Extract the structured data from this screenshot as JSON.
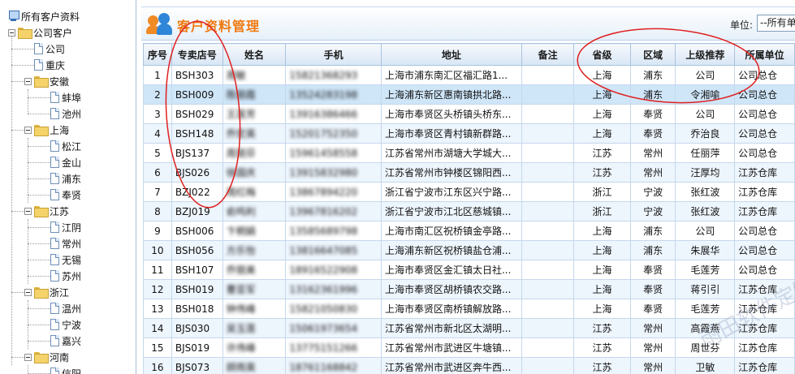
{
  "tree": {
    "root": "所有客户资料",
    "company": "公司客户",
    "nodes": [
      {
        "label": "公司",
        "level": 2,
        "type": "page"
      },
      {
        "label": "重庆",
        "level": 2,
        "type": "page"
      },
      {
        "label": "安徽",
        "level": 2,
        "type": "folder"
      },
      {
        "label": "蚌埠",
        "level": 3,
        "type": "page"
      },
      {
        "label": "池州",
        "level": 3,
        "type": "page"
      },
      {
        "label": "上海",
        "level": 2,
        "type": "folder"
      },
      {
        "label": "松江",
        "level": 3,
        "type": "page"
      },
      {
        "label": "金山",
        "level": 3,
        "type": "page"
      },
      {
        "label": "浦东",
        "level": 3,
        "type": "page"
      },
      {
        "label": "奉贤",
        "level": 3,
        "type": "page"
      },
      {
        "label": "江苏",
        "level": 2,
        "type": "folder"
      },
      {
        "label": "江阴",
        "level": 3,
        "type": "page"
      },
      {
        "label": "常州",
        "level": 3,
        "type": "page"
      },
      {
        "label": "无锡",
        "level": 3,
        "type": "page"
      },
      {
        "label": "苏州",
        "level": 3,
        "type": "page"
      },
      {
        "label": "浙江",
        "level": 2,
        "type": "folder"
      },
      {
        "label": "温州",
        "level": 3,
        "type": "page"
      },
      {
        "label": "宁波",
        "level": 3,
        "type": "page"
      },
      {
        "label": "嘉兴",
        "level": 3,
        "type": "page"
      },
      {
        "label": "河南",
        "level": 2,
        "type": "folder"
      },
      {
        "label": "信阳",
        "level": 3,
        "type": "page"
      }
    ]
  },
  "header": {
    "title": "客户资料管理",
    "unit_label": "单位:",
    "unit_value": "--所有单位--"
  },
  "columns": [
    "序号",
    "专卖店号",
    "姓名",
    "手机",
    "地址",
    "备注",
    "省级",
    "区域",
    "上级推荐",
    "所属单位"
  ],
  "rows": [
    {
      "no": "1",
      "store": "BSH303",
      "name": "周敏",
      "phone": "15821368293",
      "address": "上海市浦东南汇区福汇路1...",
      "note": "",
      "province": "上海",
      "region": "浦东",
      "referrer": "公司",
      "unit": "公司总仓"
    },
    {
      "no": "2",
      "store": "BSH009",
      "name": "陈丽霞",
      "phone": "13524283198",
      "address": "上海浦东新区惠南镇拱北路...",
      "note": "",
      "province": "上海",
      "region": "浦东",
      "referrer": "令湘喻",
      "unit": "公司总仓"
    },
    {
      "no": "3",
      "store": "BSH029",
      "name": "王莲芳",
      "phone": "13916386466",
      "address": "上海市奉贤区头桥镇头桥东...",
      "note": "",
      "province": "上海",
      "region": "奉贤",
      "referrer": "公司",
      "unit": "公司总仓"
    },
    {
      "no": "4",
      "store": "BSH148",
      "name": "乔宏英",
      "phone": "15201752350",
      "address": "上海市奉贤区青村镇新群路...",
      "note": "",
      "province": "上海",
      "region": "奉贤",
      "referrer": "乔治良",
      "unit": "公司总仓"
    },
    {
      "no": "5",
      "store": "BJS137",
      "name": "周丽芬",
      "phone": "15961458558",
      "address": "江苏省常州市湖塘大学城大...",
      "note": "",
      "province": "江苏",
      "region": "常州",
      "referrer": "任丽萍",
      "unit": "公司总仓"
    },
    {
      "no": "6",
      "store": "BJS026",
      "name": "徐国庆",
      "phone": "13915832980",
      "address": "江苏省常州市钟楼区锦阳西...",
      "note": "",
      "province": "江苏",
      "region": "常州",
      "referrer": "汪厚均",
      "unit": "江苏仓库"
    },
    {
      "no": "7",
      "store": "BZJ022",
      "name": "周红梅",
      "phone": "13867894220",
      "address": "浙江省宁波市江东区兴宁路...",
      "note": "",
      "province": "浙江",
      "region": "宁波",
      "referrer": "张红波",
      "unit": "江苏仓库"
    },
    {
      "no": "8",
      "store": "BZJ019",
      "name": "俞鸣利",
      "phone": "13967816202",
      "address": "浙江省宁波市江北区慈城镇...",
      "note": "",
      "province": "浙江",
      "region": "宁波",
      "referrer": "张红波",
      "unit": "江苏仓库"
    },
    {
      "no": "9",
      "store": "BSH006",
      "name": "卞桐娟",
      "phone": "13585689798",
      "address": "上海市南汇区祝桥镇金亭路...",
      "note": "",
      "province": "上海",
      "region": "浦东",
      "referrer": "公司",
      "unit": "公司总仓"
    },
    {
      "no": "10",
      "store": "BSH056",
      "name": "方乐怡",
      "phone": "13816647085",
      "address": "上海浦东新区祝桥镇盐仓浦...",
      "note": "",
      "province": "上海",
      "region": "浦东",
      "referrer": "朱展华",
      "unit": "公司总仓"
    },
    {
      "no": "11",
      "store": "BSH107",
      "name": "乔丽美",
      "phone": "18916522908",
      "address": "上海市奉贤区金汇镇太日社...",
      "note": "",
      "province": "上海",
      "region": "奉贤",
      "referrer": "毛莲芳",
      "unit": "公司总仓"
    },
    {
      "no": "12",
      "store": "BSH019",
      "name": "曹亚军",
      "phone": "13162361996",
      "address": "上海市奉贤区胡桥镇农交路...",
      "note": "",
      "province": "上海",
      "region": "奉贤",
      "referrer": "蒋引引",
      "unit": "江苏仓库"
    },
    {
      "no": "13",
      "store": "BSH018",
      "name": "钟伟峰",
      "phone": "15821050830",
      "address": "上海市奉贤区南桥镇解放路...",
      "note": "",
      "province": "上海",
      "region": "奉贤",
      "referrer": "毛莲芳",
      "unit": "江苏仓库"
    },
    {
      "no": "14",
      "store": "BJS030",
      "name": "吴玉莲",
      "phone": "15061973654",
      "address": "江苏省常州市新北区太湖明...",
      "note": "",
      "province": "江苏",
      "region": "常州",
      "referrer": "高霞燕",
      "unit": "江苏仓库"
    },
    {
      "no": "15",
      "store": "BJS019",
      "name": "许伟峰",
      "phone": "13775151266",
      "address": "江苏省常州市武进区牛塘镇...",
      "note": "",
      "province": "江苏",
      "region": "常州",
      "referrer": "周世芬",
      "unit": "江苏仓库"
    },
    {
      "no": "16",
      "store": "BJS073",
      "name": "顾雨英",
      "phone": "18761168842",
      "address": "江苏省常州市武进区奔牛西...",
      "note": "",
      "province": "江苏",
      "region": "常州",
      "referrer": "卫敏",
      "unit": "江苏仓库"
    }
  ],
  "selected_row": 2,
  "watermark": "雨田软件定制",
  "colors": {
    "title": "#f07a12",
    "header_bg": "#d8e6f5",
    "row_alt": "#edf5fd",
    "row_selected": "#cfe6f9",
    "annotation_red": "#e02020"
  }
}
